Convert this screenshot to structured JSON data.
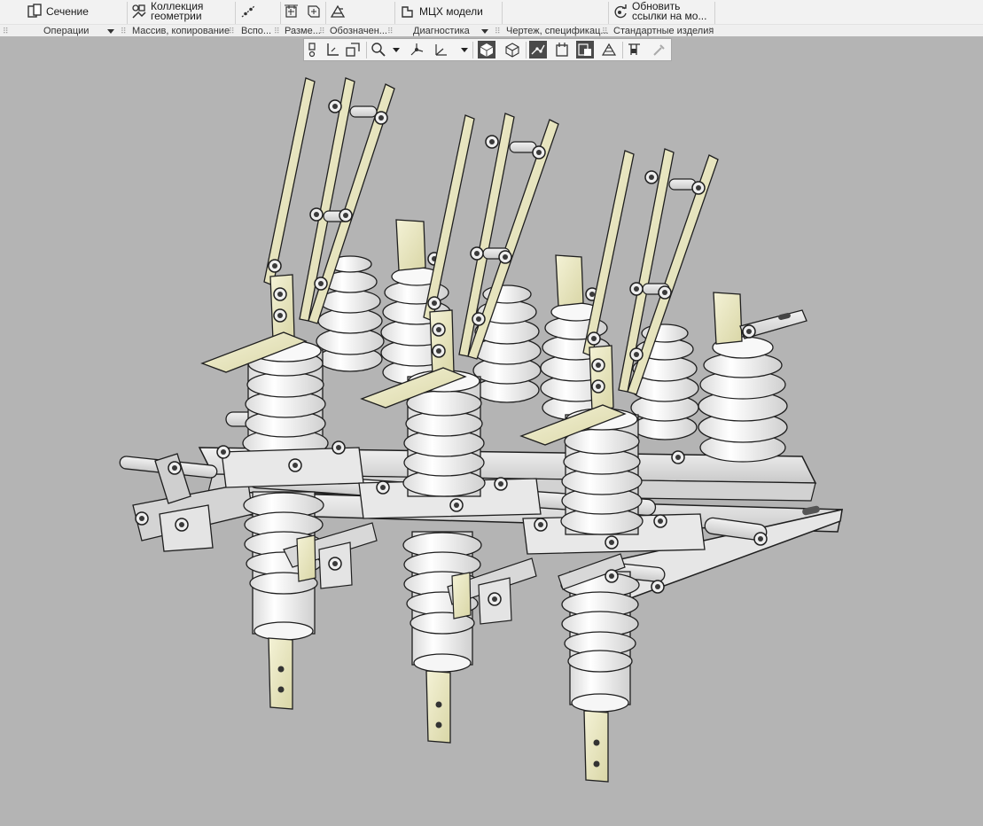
{
  "ribbon": {
    "buttons": {
      "section": "Сечение",
      "geometry_collection_line1": "Коллекция",
      "geometry_collection_line2": "геометрии",
      "mcx_model": "МЦХ модели",
      "update_links_line1": "Обновить",
      "update_links_line2": "ссылки на мо..."
    },
    "groups": {
      "operations": "Операции",
      "array_copy": "Массив, копирование",
      "auxiliary": "Вспо...",
      "dimensions": "Разме...",
      "designations": "Обозначен...",
      "diagnostics": "Диагностика",
      "drawing_spec": "Чертеж, спецификац...",
      "standard_parts": "Стандартные изделия"
    }
  },
  "colors": {
    "ribbon_bg": "#f2f2f2",
    "viewport_bg": "#b4b4b4",
    "toolbar_active": "#4a4a4a",
    "porcelain": "#f2f2f2",
    "blade": "#e8e6bf",
    "steel": "#dcdcdc",
    "outline": "#1f1f1f"
  },
  "icons": {
    "section": "section-icon",
    "geometry_collection": "geometry-collection-icon",
    "auxiliary": "auxiliary-curve-icon",
    "dimensions": "dimension-icon",
    "designations": "designation-icon",
    "mcx": "mass-properties-icon",
    "update": "update-links-icon"
  },
  "model": {
    "description": "three-pole disconnector assembly with porcelain insulators"
  }
}
